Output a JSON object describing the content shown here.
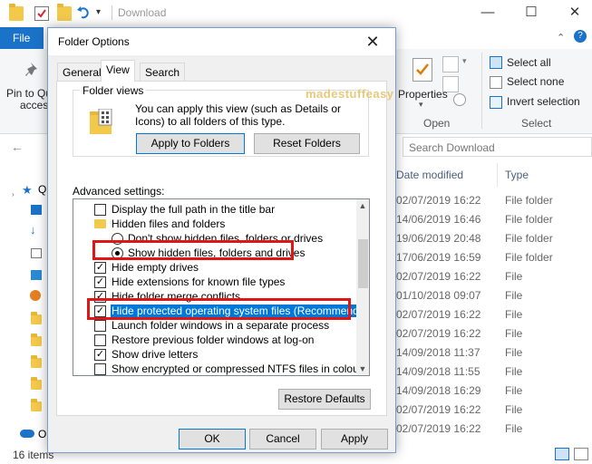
{
  "explorer": {
    "window_title": "Download",
    "file_tab": "File",
    "ribbon": {
      "pin_label_1": "Pin to Qu",
      "pin_label_2": "access",
      "properties": "Properties",
      "open_group": "Open",
      "select_all": "Select all",
      "select_none": "Select none",
      "invert_selection": "Invert selection",
      "select_group": "Select"
    },
    "search_placeholder": "Search Download",
    "columns": {
      "date": "Date modified",
      "type": "Type"
    },
    "rows": [
      {
        "date": "02/07/2019 16:22",
        "type": "File folder"
      },
      {
        "date": "14/06/2019 16:46",
        "type": "File folder"
      },
      {
        "date": "19/06/2019 20:48",
        "type": "File folder"
      },
      {
        "date": "17/06/2019 16:59",
        "type": "File folder"
      },
      {
        "date": "02/07/2019 16:22",
        "type": "File"
      },
      {
        "date": "01/10/2018 09:07",
        "type": "File"
      },
      {
        "date": "02/07/2019 16:22",
        "type": "File"
      },
      {
        "date": "02/07/2019 16:22",
        "type": "File"
      },
      {
        "date": "14/09/2018 11:37",
        "type": "File"
      },
      {
        "date": "14/09/2018 11:55",
        "type": "File"
      },
      {
        "date": "14/09/2018 16:29",
        "type": "File"
      },
      {
        "date": "02/07/2019 16:22",
        "type": "File"
      },
      {
        "date": "02/07/2019 16:22",
        "type": "File"
      }
    ],
    "nav_quick": "Q",
    "nav_onedrive": "O",
    "status": "16 items"
  },
  "dialog": {
    "title": "Folder Options",
    "tabs": [
      "General",
      "View",
      "Search"
    ],
    "folder_views": {
      "label": "Folder views",
      "description": "You can apply this view (such as Details or Icons) to all folders of this type.",
      "apply_button": "Apply to Folders",
      "reset_button": "Reset Folders"
    },
    "advanced_label": "Advanced settings:",
    "items": [
      {
        "kind": "checkbox",
        "label": "Display the full path in the title bar",
        "checked": false
      },
      {
        "kind": "folder",
        "label": "Hidden files and folders"
      },
      {
        "kind": "radio",
        "label": "Don't show hidden files, folders or drives",
        "checked": false
      },
      {
        "kind": "radio",
        "label": "Show hidden files, folders and drives",
        "checked": true
      },
      {
        "kind": "checkbox",
        "label": "Hide empty drives",
        "checked": true
      },
      {
        "kind": "checkbox",
        "label": "Hide extensions for known file types",
        "checked": true
      },
      {
        "kind": "checkbox",
        "label": "Hide folder merge conflicts",
        "checked": true
      },
      {
        "kind": "checkbox",
        "label": "Hide protected operating system files (Recommended)",
        "checked": true
      },
      {
        "kind": "checkbox",
        "label": "Launch folder windows in a separate process",
        "checked": false
      },
      {
        "kind": "checkbox",
        "label": "Restore previous folder windows at log-on",
        "checked": false
      },
      {
        "kind": "checkbox",
        "label": "Show drive letters",
        "checked": true
      },
      {
        "kind": "checkbox",
        "label": "Show encrypted or compressed NTFS files in colour",
        "checked": false
      }
    ],
    "restore_defaults": "Restore Defaults",
    "ok": "OK",
    "cancel": "Cancel",
    "apply": "Apply",
    "close_glyph": "✕",
    "check_glyph": "✓"
  },
  "watermark": "madestuffeasy",
  "colors": {
    "highlight": "#e01616",
    "selection": "#0078d7",
    "accent": "#1a73c9"
  }
}
